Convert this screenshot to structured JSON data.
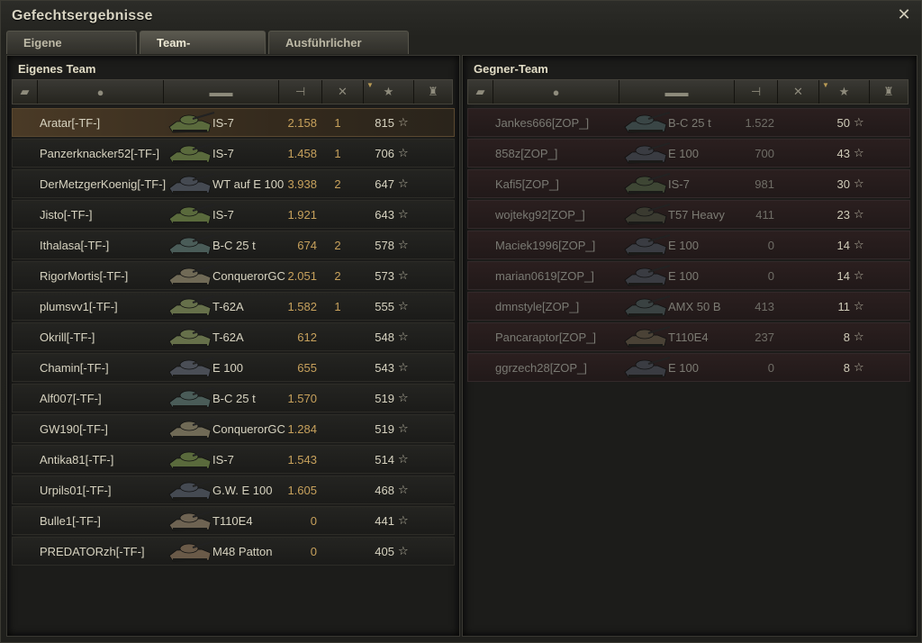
{
  "window": {
    "title": "Gefechtsergebnisse",
    "close_icon": "close-icon"
  },
  "tabs": [
    {
      "label": "Eigene Auswertung",
      "active": false
    },
    {
      "label": "Team-Auswertung",
      "active": true
    },
    {
      "label": "Ausführlicher Bericht",
      "active": false
    }
  ],
  "own_team": {
    "title": "Eigenes Team",
    "header_icons": [
      "platoon-icon",
      "player-icon",
      "tank-icon",
      "damage-icon",
      "kills-icon",
      "xp-star-icon",
      "medal-icon"
    ],
    "rows": [
      {
        "player": "Aratar[-TF-]",
        "tank": "IS-7",
        "damage": "2.158",
        "kills": "1",
        "xp": "815",
        "highlight": true,
        "tank_color": "#5a6a3c"
      },
      {
        "player": "Panzerknacker52[-TF-]",
        "tank": "IS-7",
        "damage": "1.458",
        "kills": "1",
        "xp": "706",
        "tank_color": "#5a6a3c"
      },
      {
        "player": "DerMetzgerKoenig[-TF-]",
        "tank": "WT auf E 100",
        "damage": "3.938",
        "kills": "2",
        "xp": "647",
        "tank_color": "#454a52"
      },
      {
        "player": "Jisto[-TF-]",
        "tank": "IS-7",
        "damage": "1.921",
        "kills": "",
        "xp": "643",
        "tank_color": "#5a6a3c"
      },
      {
        "player": "Ithalasa[-TF-]",
        "tank": "B-C 25 t",
        "damage": "674",
        "kills": "2",
        "xp": "578",
        "tank_color": "#4a5c58"
      },
      {
        "player": "RigorMortis[-TF-]",
        "tank": "ConquerorGC",
        "damage": "2.051",
        "kills": "2",
        "xp": "573",
        "tank_color": "#706a56"
      },
      {
        "player": "plumsvv1[-TF-]",
        "tank": "T-62A",
        "damage": "1.582",
        "kills": "1",
        "xp": "555",
        "tank_color": "#66704a"
      },
      {
        "player": "Okrill[-TF-]",
        "tank": "T-62A",
        "damage": "612",
        "kills": "",
        "xp": "548",
        "tank_color": "#66704a"
      },
      {
        "player": "Chamin[-TF-]",
        "tank": "E 100",
        "damage": "655",
        "kills": "",
        "xp": "543",
        "tank_color": "#4a4e56"
      },
      {
        "player": "Alf007[-TF-]",
        "tank": "B-C 25 t",
        "damage": "1.570",
        "kills": "",
        "xp": "519",
        "tank_color": "#4a5c58"
      },
      {
        "player": "GW190[-TF-]",
        "tank": "ConquerorGC",
        "damage": "1.284",
        "kills": "",
        "xp": "519",
        "tank_color": "#706a56"
      },
      {
        "player": "Antika81[-TF-]",
        "tank": "IS-7",
        "damage": "1.543",
        "kills": "",
        "xp": "514",
        "tank_color": "#5a6a3c"
      },
      {
        "player": "Urpils01[-TF-]",
        "tank": "G.W. E 100",
        "damage": "1.605",
        "kills": "",
        "xp": "468",
        "tank_color": "#454a52"
      },
      {
        "player": "Bulle1[-TF-]",
        "tank": "T110E4",
        "damage": "0",
        "kills": "",
        "xp": "441",
        "tank_color": "#6e6352"
      },
      {
        "player": "PREDATORzh[-TF-]",
        "tank": "M48 Patton",
        "damage": "0",
        "kills": "",
        "xp": "405",
        "tank_color": "#6a5a48"
      }
    ]
  },
  "enemy_team": {
    "title": "Gegner-Team",
    "header_icons": [
      "platoon-icon",
      "player-icon",
      "tank-icon",
      "damage-icon",
      "kills-icon",
      "xp-star-icon",
      "medal-icon"
    ],
    "rows": [
      {
        "player": "Jankes666[ZOP_]",
        "tank": "B-C 25 t",
        "damage": "1.522",
        "kills": "",
        "xp": "50",
        "tank_color": "#3a4646"
      },
      {
        "player": "858z[ZOP_]",
        "tank": "E 100",
        "damage": "700",
        "kills": "",
        "xp": "43",
        "tank_color": "#3a3c42"
      },
      {
        "player": "Kafi5[ZOP_]",
        "tank": "IS-7",
        "damage": "981",
        "kills": "",
        "xp": "30",
        "tank_color": "#3e4634"
      },
      {
        "player": "wojtekg92[ZOP_]",
        "tank": "T57 Heavy",
        "damage": "411",
        "kills": "",
        "xp": "23",
        "tank_color": "#3a3a30"
      },
      {
        "player": "Maciek1996[ZOP_]",
        "tank": "E 100",
        "damage": "0",
        "kills": "",
        "xp": "14",
        "tank_color": "#3a3c42"
      },
      {
        "player": "marian0619[ZOP_]",
        "tank": "E 100",
        "damage": "0",
        "kills": "",
        "xp": "14",
        "tank_color": "#3a3c42"
      },
      {
        "player": "dmnstyle[ZOP_]",
        "tank": "AMX 50 B",
        "damage": "413",
        "kills": "",
        "xp": "11",
        "tank_color": "#3a4242"
      },
      {
        "player": "Pancaraptor[ZOP_]",
        "tank": "T110E4",
        "damage": "237",
        "kills": "",
        "xp": "8",
        "tank_color": "#4a4236"
      },
      {
        "player": "ggrzech28[ZOP_]",
        "tank": "E 100",
        "damage": "0",
        "kills": "",
        "xp": "8",
        "tank_color": "#3a3c42"
      }
    ]
  }
}
